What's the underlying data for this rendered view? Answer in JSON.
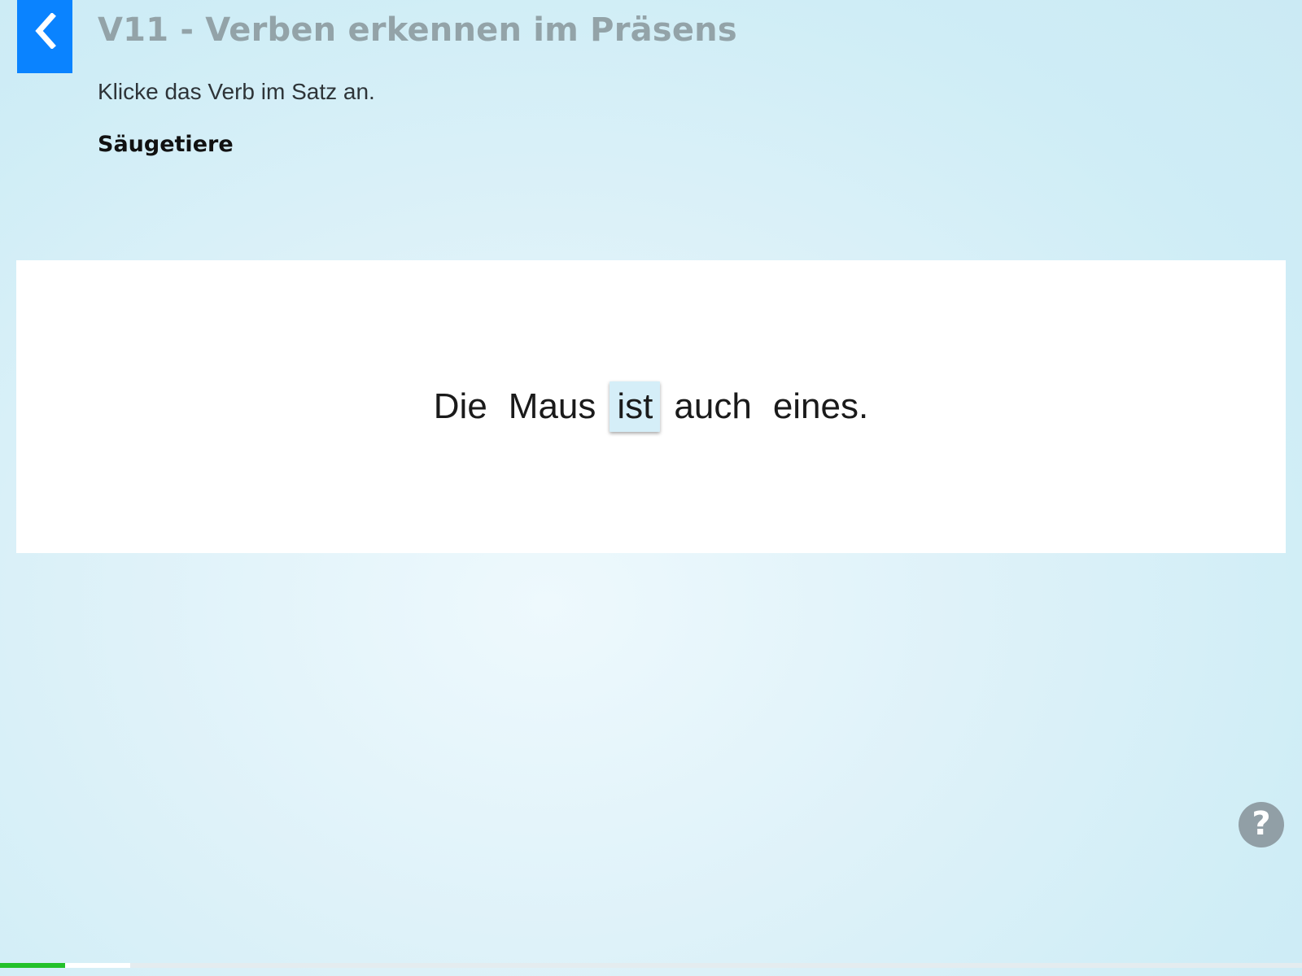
{
  "header": {
    "back_icon": "chevron-left-icon",
    "title": "V11 - Verben erkennen im Präsens",
    "instruction": "Klicke das Verb im Satz an.",
    "topic": "Säugetiere"
  },
  "exercise": {
    "words": [
      {
        "text": "Die",
        "selected": false
      },
      {
        "text": "Maus",
        "selected": false
      },
      {
        "text": "ist",
        "selected": true
      },
      {
        "text": "auch",
        "selected": false
      },
      {
        "text": "eines.",
        "selected": false
      }
    ]
  },
  "help": {
    "icon": "question-mark-icon",
    "glyph": "?"
  },
  "progress": {
    "completed_segments": 1,
    "current_segment": 2
  },
  "colors": {
    "accent": "#0a83ff",
    "title": "#93a3a8",
    "selected_word": "#d5eef8",
    "progress_done": "#22c12a",
    "help_button": "#919fa6"
  }
}
